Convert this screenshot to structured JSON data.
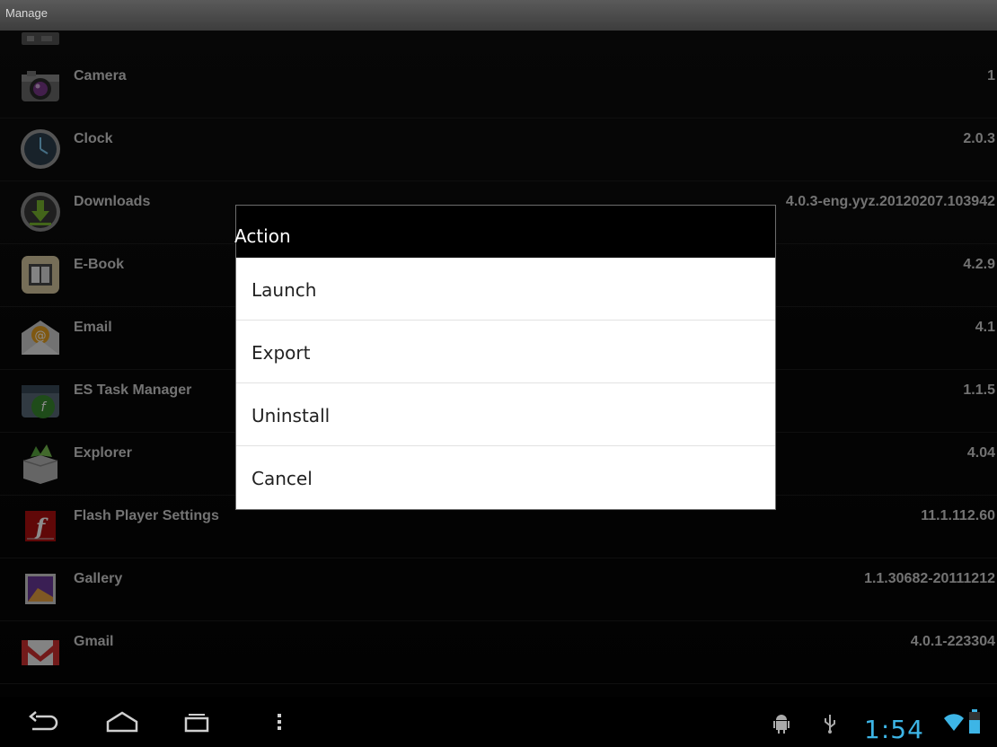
{
  "title_bar": {
    "title": "Manage"
  },
  "apps": [
    {
      "name": "Camera",
      "version": "1",
      "icon": "camera-icon"
    },
    {
      "name": "Clock",
      "version": "2.0.3",
      "icon": "clock-icon"
    },
    {
      "name": "Downloads",
      "version": "4.0.3-eng.yyz.20120207.103942",
      "icon": "download-icon"
    },
    {
      "name": "E-Book",
      "version": "4.2.9",
      "icon": "ebook-icon"
    },
    {
      "name": "Email",
      "version": "4.1",
      "icon": "email-icon"
    },
    {
      "name": "ES Task Manager",
      "version": "1.1.5",
      "icon": "task-manager-icon"
    },
    {
      "name": "Explorer",
      "version": "4.04",
      "icon": "explorer-icon"
    },
    {
      "name": "Flash Player Settings",
      "version": "11.1.112.60",
      "icon": "flash-icon"
    },
    {
      "name": "Gallery",
      "version": "1.1.30682-20111212",
      "icon": "gallery-icon"
    },
    {
      "name": "Gmail",
      "version": "4.0.1-223304",
      "icon": "gmail-icon"
    }
  ],
  "dialog": {
    "title": "Action",
    "options": [
      "Launch",
      "Export",
      "Uninstall",
      "Cancel"
    ]
  },
  "navbar": {
    "time": "1:54",
    "icons": [
      "back-icon",
      "home-icon",
      "recent-apps-icon",
      "menu-icon",
      "android-debug-icon",
      "usb-icon",
      "wifi-icon",
      "battery-icon"
    ],
    "accent_color": "#3db5e6"
  }
}
